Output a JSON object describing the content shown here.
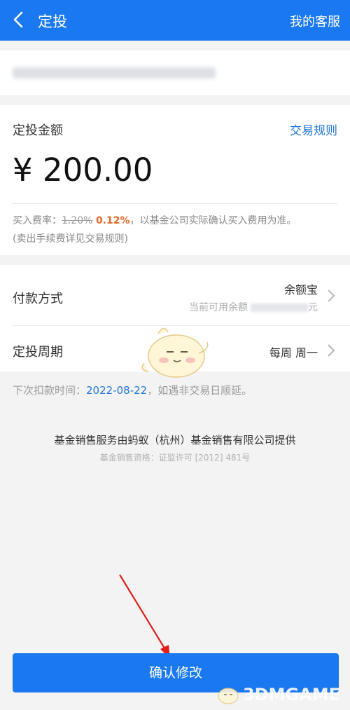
{
  "header": {
    "title": "定投",
    "service_label": "我的客服"
  },
  "amount": {
    "label": "定投金额",
    "rules_link": "交易规则",
    "value": "¥ 200.00"
  },
  "fee": {
    "prefix": "买入费率：",
    "original_rate": "1.20%",
    "discount_rate": "0.12%",
    "suffix": "，以基金公司实际确认买入费用为准。",
    "note": "(卖出手续费详见交易规则)"
  },
  "payment": {
    "label": "付款方式",
    "method": "余额宝",
    "balance_prefix": "当前可用余额",
    "balance_suffix": "元"
  },
  "cycle": {
    "label": "定投周期",
    "value": "每周 周一"
  },
  "next_deduct": {
    "prefix": "下次扣款时间：",
    "date": "2022-08-22",
    "suffix": "，如遇非交易日顺延。"
  },
  "provider": {
    "text": "基金销售服务由蚂蚁（杭州）基金销售有限公司提供",
    "license": "基金销售资格：证监许可 [2012] 481号"
  },
  "confirm_button": "确认修改",
  "watermark": "3DMGAME",
  "colors": {
    "primary": "#1a78f0",
    "link": "#2377d6",
    "discount": "#e26a2c",
    "annotation_arrow": "#e0211a"
  }
}
